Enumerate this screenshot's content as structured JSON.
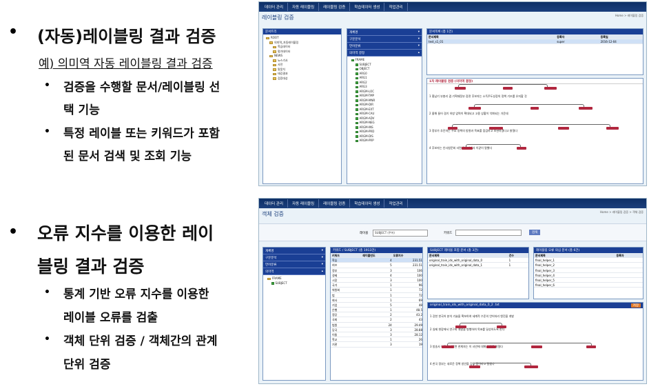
{
  "left": {
    "bullet1_marker": "•",
    "bullet1": "(자동)레이블링 결과 검증",
    "bullet1_example": "예) 의미역 자동 레이블링 결과 검증",
    "bullet1_subs": [
      {
        "marker": "•",
        "line1": "검증을 수행할 문서/레이블링 선",
        "line2": "택 기능"
      },
      {
        "marker": "•",
        "line1": "특정 레이블 또는 키워드가 포함",
        "line2": "된 문서 검색 및 조회 기능"
      }
    ],
    "bullet2_marker": "•",
    "bullet2_line1": "오류 지수를 이용한 레이",
    "bullet2_line2": "블링 결과 검증",
    "bullet2_subs": [
      {
        "marker": "•",
        "line1": "통계 기반 오류 지수를 이용한",
        "line2": "레이블 오류를 검출"
      },
      {
        "marker": "•",
        "line1": "객체 단위 검증 / 객체간의 관계",
        "line2": "단위 검증"
      }
    ]
  },
  "shot1": {
    "nav": [
      "데이터 관리",
      "자동 레이블링",
      "레이블링 검증",
      "학습데이터 생성",
      "작업관리"
    ],
    "title": "레이블링 검증",
    "breadcrumb": "Home > 레이블링 검증",
    "tree_header": "문서트리",
    "tree": [
      "ROOT",
      "의미역_자동레이블링",
      "학습데이터",
      "평가데이터",
      "NEWS",
      "뉴스기사",
      "사전",
      "말뭉치",
      "태깅결과",
      "검증대상"
    ],
    "menu": [
      "개체명",
      "구문분석",
      "언어분류",
      "의미역 결정"
    ],
    "label_tree": [
      "FRAME",
      "SUBJECT",
      "OBJECT",
      "ARG0",
      "ARG1",
      "ARG2",
      "ARG3",
      "ARGM-LOC",
      "ARGM-TMP",
      "ARGM-MNR",
      "ARGM-DIR",
      "ARGM-EXT",
      "ARGM-CAU",
      "ARGM-ADV",
      "ARGM-NEG",
      "ARGM-INS",
      "ARGM-PRD",
      "ARGM-DIS",
      "ARGM-PRP"
    ],
    "list_header": "문서목록 (총 1건)",
    "list_cols": [
      "문서제목",
      "등록자",
      "등록일"
    ],
    "list_rows": [
      [
        "test_s1_01",
        "super",
        "2016-12-04"
      ]
    ],
    "viewer_header": "1차 레이블링 검증 (의미역 결정)",
    "viewer_lines": [
      "1 홍남기 부총리 겸 기획재정부 장관 후보자는 소득주도성장의 정책 기조를 유지할 것",
      "2 올해 들어 경기 하방 압력이 확대되고 고용 상황이 악화되는 가운데",
      "3 정부가 추진하는 주요 정책의 방향과 목표를 점검하고 보완하겠다고 밝혔다",
      "4 후보자는 인사청문회 서면 답변서에서 이같이 말했다"
    ]
  },
  "shot2": {
    "nav": [
      "데이터 관리",
      "자동 레이블링",
      "레이블링 검증",
      "학습데이터 생성",
      "작업관리"
    ],
    "title": "객체 검증",
    "breadcrumb": "Home > 레이블링 검증 > 객체 검증",
    "label_field": "레이블",
    "label_value": "SUBJECT (주어)",
    "keyword_field": "키워드",
    "search_btn": "검색",
    "menu": [
      "개체명",
      "구문분석",
      "언어분류",
      "의미역"
    ],
    "tree": [
      "FRAME",
      "SUBJECT"
    ],
    "stat_header": "키워드 / SUBJECT (총 1913건)",
    "stat_cols": [
      "키워드",
      "레이블빈도",
      "오류지수"
    ],
    "stat_rows": [
      [
        "학습",
        "4",
        "231.51"
      ],
      [
        "허브",
        "5",
        "231.51"
      ],
      [
        "정부",
        "3",
        "106"
      ],
      [
        "경제",
        "4",
        "100"
      ],
      [
        "시장",
        "3",
        "100"
      ],
      [
        "국가",
        "1",
        "96"
      ],
      [
        "위원회",
        "1",
        "72"
      ],
      [
        "법",
        "1",
        "72"
      ],
      [
        "회사",
        "1",
        "69"
      ],
      [
        "기업",
        "5",
        "48"
      ],
      [
        "은행",
        "1",
        "48.5"
      ],
      [
        "정당",
        "2",
        "43.2"
      ],
      [
        "국회",
        "2",
        "43"
      ],
      [
        "법원",
        "24",
        "29.49"
      ],
      [
        "당국",
        "3",
        "28.88"
      ],
      [
        "이들",
        "3",
        "28.12"
      ],
      [
        "학교",
        "1",
        "26"
      ],
      [
        "기관",
        "3",
        "19"
      ]
    ],
    "doc_header": "SUBJECT 레이블 포함 문서 (총 3건)",
    "doc_cols": [
      "문서제목",
      "건수"
    ],
    "doc_rows": [
      [
        "original_train_ids_with_original_data_0",
        "1"
      ],
      [
        "original_train_ids_with_original_data_1",
        "1"
      ]
    ],
    "err_header": "레이블링 오류 의심 문서 (총 6건)",
    "err_cols": [
      "문서제목",
      "등록자"
    ],
    "err_rows": [
      [
        "final_helper_1"
      ],
      [
        "final_helper_2"
      ],
      [
        "final_helper_3"
      ],
      [
        "final_helper_4"
      ],
      [
        "final_helper_5"
      ],
      [
        "final_helper_6"
      ]
    ],
    "viewer_header": "original_train_ids_with_original_data_0_2 .txt",
    "viewer_btn": "저장",
    "viewer_lines": [
      "1 강한 한국어 분석 기술을 확보하여 세계적 수준의 언어처리 엔진을 개발",
      "2 실제 현장에서 연구와 개발을 병행하여 목표를 달성하도록 한다",
      "3 방송사 보도에 따르면 관계자는 이 사안에 대해 입장을 밝혔다",
      "4 한국 정부는 새로운 정책 방안을 검토 중이라고 말했다"
    ]
  }
}
